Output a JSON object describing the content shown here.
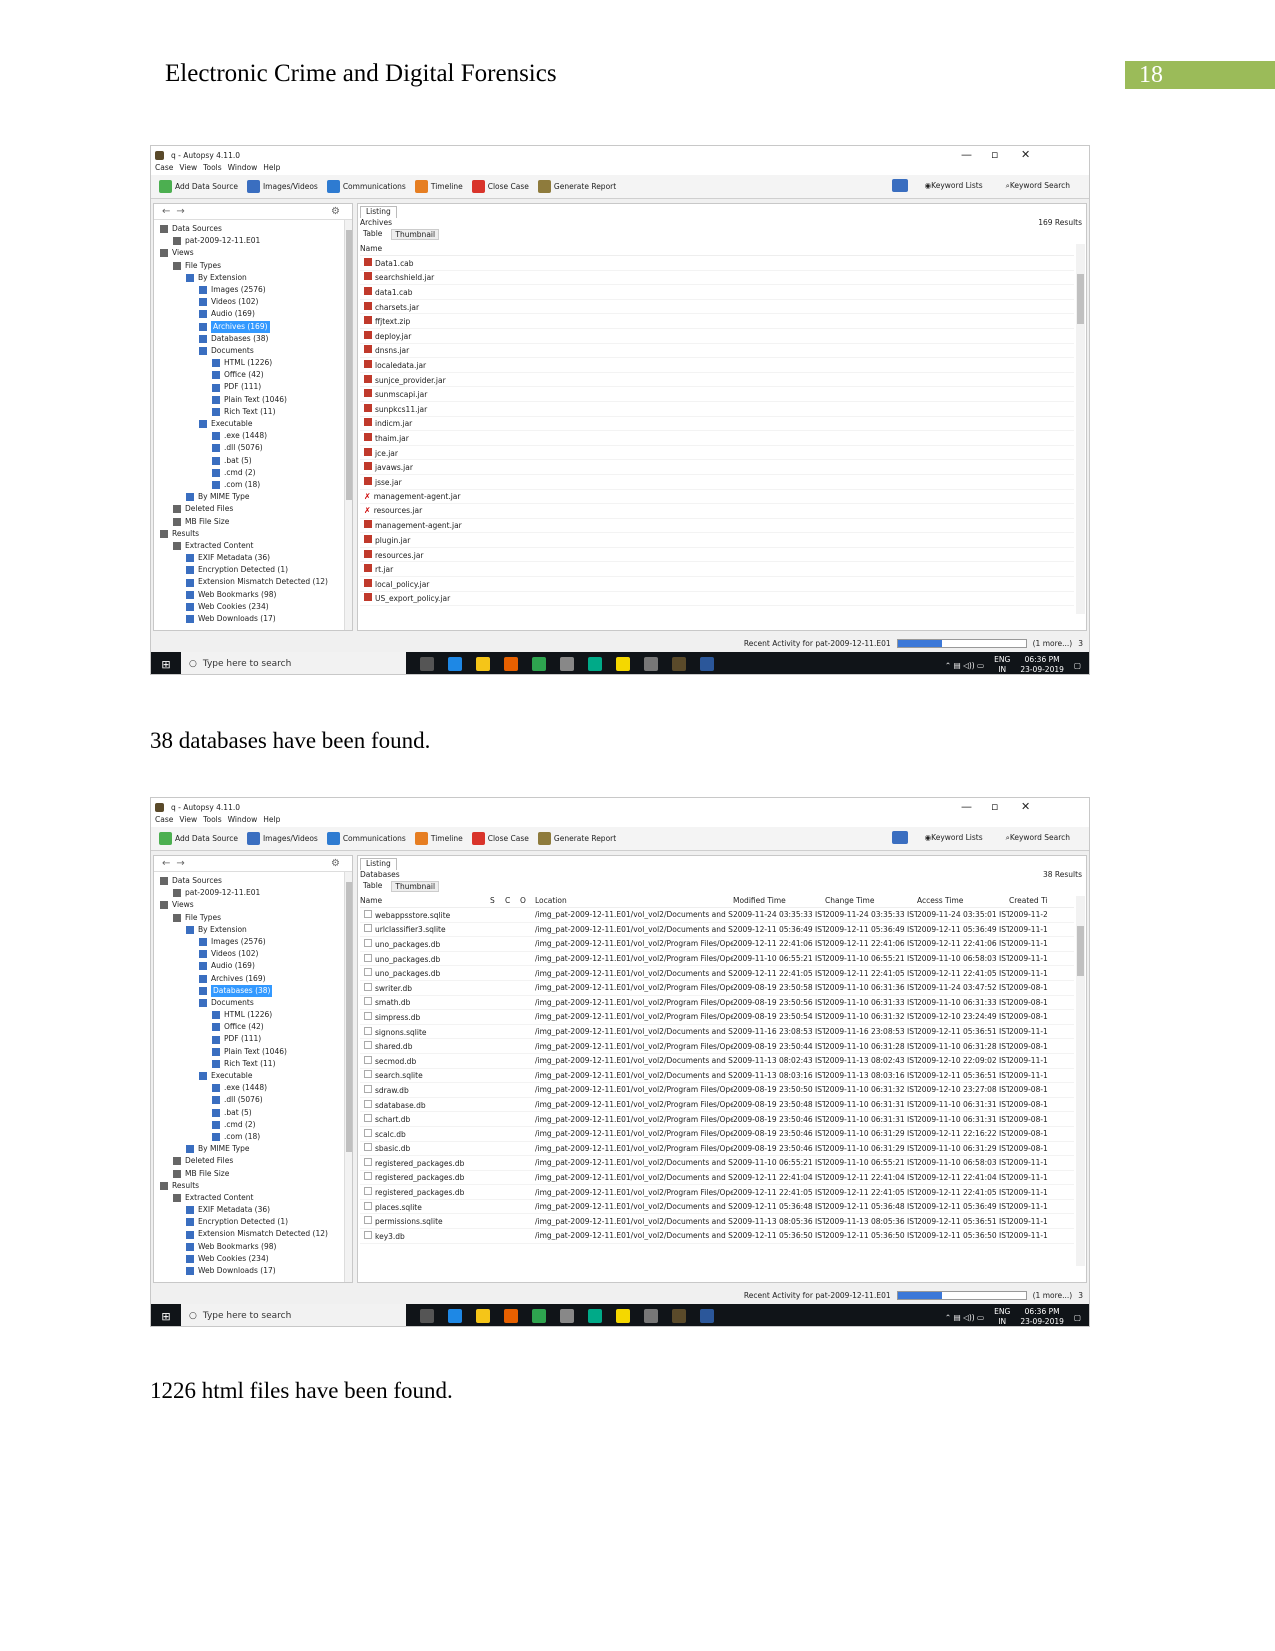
{
  "header": {
    "title": "Electronic Crime and Digital Forensics",
    "page_number": "18"
  },
  "captions": [
    "38 databases have been found.",
    "1226 html files have been found."
  ],
  "app": {
    "window_title": "q - Autopsy 4.11.0",
    "menu": [
      "Case",
      "View",
      "Tools",
      "Window",
      "Help"
    ],
    "toolbar": [
      "Add Data Source",
      "Images/Videos",
      "Communications",
      "Timeline",
      "Close Case",
      "Generate Report"
    ],
    "toolbar_right": [
      "Keyword Lists",
      "Keyword Search"
    ],
    "listing_tab": "Listing",
    "subtabs": [
      "Table",
      "Thumbnail"
    ],
    "tree": [
      {
        "label": "Data Sources",
        "indent": 0
      },
      {
        "label": "pat-2009-12-11.E01",
        "indent": 1
      },
      {
        "label": "Views",
        "indent": 0
      },
      {
        "label": "File Types",
        "indent": 1
      },
      {
        "label": "By Extension",
        "indent": 2
      },
      {
        "label": "Images (2576)",
        "indent": 3
      },
      {
        "label": "Videos (102)",
        "indent": 3
      },
      {
        "label": "Audio (169)",
        "indent": 3
      },
      {
        "label": "Archives (169)",
        "indent": 3
      },
      {
        "label": "Databases (38)",
        "indent": 3
      },
      {
        "label": "Documents",
        "indent": 3
      },
      {
        "label": "HTML (1226)",
        "indent": 4
      },
      {
        "label": "Office (42)",
        "indent": 4
      },
      {
        "label": "PDF (111)",
        "indent": 4
      },
      {
        "label": "Plain Text (1046)",
        "indent": 4
      },
      {
        "label": "Rich Text (11)",
        "indent": 4
      },
      {
        "label": "Executable",
        "indent": 3
      },
      {
        "label": ".exe (1448)",
        "indent": 4
      },
      {
        "label": ".dll (5076)",
        "indent": 4
      },
      {
        "label": ".bat (5)",
        "indent": 4
      },
      {
        "label": ".cmd (2)",
        "indent": 4
      },
      {
        "label": ".com (18)",
        "indent": 4
      },
      {
        "label": "By MIME Type",
        "indent": 2
      },
      {
        "label": "Deleted Files",
        "indent": 1
      },
      {
        "label": "MB File Size",
        "indent": 1
      },
      {
        "label": "Results",
        "indent": 0
      },
      {
        "label": "Extracted Content",
        "indent": 1
      },
      {
        "label": "EXIF Metadata (36)",
        "indent": 2
      },
      {
        "label": "Encryption Detected (1)",
        "indent": 2
      },
      {
        "label": "Extension Mismatch Detected (12)",
        "indent": 2
      },
      {
        "label": "Web Bookmarks (98)",
        "indent": 2
      },
      {
        "label": "Web Cookies (234)",
        "indent": 2
      },
      {
        "label": "Web Downloads (17)",
        "indent": 2
      }
    ],
    "status": {
      "recent_activity": "Recent Activity for pat-2009-12-11.E01",
      "progress_label": "35%",
      "progress": 0.35,
      "more": "(1 more...)",
      "count": "3"
    },
    "taskbar": {
      "search_placeholder": "Type here to search",
      "lang": "ENG",
      "region": "IN",
      "time": "06:36 PM",
      "date": "23-09-2019"
    }
  },
  "screens": [
    {
      "result_title": "Archives",
      "result_count": "169 Results",
      "selected_tree": "Archives (169)",
      "columns": [
        "Name"
      ],
      "rows": [
        [
          "Data1.cab",
          "f"
        ],
        [
          "searchshield.jar",
          "f"
        ],
        [
          "data1.cab",
          "f"
        ],
        [
          "charsets.jar",
          "f"
        ],
        [
          "ffjtext.zip",
          "f"
        ],
        [
          "deploy.jar",
          "f"
        ],
        [
          "dnsns.jar",
          "f"
        ],
        [
          "localedata.jar",
          "f"
        ],
        [
          "sunjce_provider.jar",
          "f"
        ],
        [
          "sunmscapi.jar",
          "f"
        ],
        [
          "sunpkcs11.jar",
          "f"
        ],
        [
          "indicm.jar",
          "f"
        ],
        [
          "thaim.jar",
          "f"
        ],
        [
          "jce.jar",
          "f"
        ],
        [
          "javaws.jar",
          "f"
        ],
        [
          "jsse.jar",
          "f"
        ],
        [
          "management-agent.jar",
          "x"
        ],
        [
          "resources.jar",
          "x"
        ],
        [
          "management-agent.jar",
          "f"
        ],
        [
          "plugin.jar",
          "f"
        ],
        [
          "resources.jar",
          "f"
        ],
        [
          "rt.jar",
          "f"
        ],
        [
          "local_policy.jar",
          "f"
        ],
        [
          "US_export_policy.jar",
          "f"
        ]
      ]
    },
    {
      "result_title": "Databases",
      "result_count": "38 Results",
      "selected_tree": "Databases (38)",
      "columns": [
        "Name",
        "S",
        "C",
        "O",
        "Location",
        "Modified Time",
        "Change Time",
        "Access Time",
        "Created Ti"
      ],
      "rows": [
        [
          "webappsstore.sqlite",
          "/img_pat-2009-12-11.E01/vol_vol2/Documents and Setting...",
          "2009-11-24 03:35:33 IST",
          "2009-11-24 03:35:33 IST",
          "2009-11-24 03:35:01 IST",
          "2009-11-2"
        ],
        [
          "urlclassifier3.sqlite",
          "/img_pat-2009-12-11.E01/vol_vol2/Documents and Setting...",
          "2009-12-11 05:36:49 IST",
          "2009-12-11 05:36:49 IST",
          "2009-12-11 05:36:49 IST",
          "2009-11-1"
        ],
        [
          "uno_packages.db",
          "/img_pat-2009-12-11.E01/vol_vol2/Program Files/OpenOffi...",
          "2009-12-11 22:41:06 IST",
          "2009-12-11 22:41:06 IST",
          "2009-12-11 22:41:06 IST",
          "2009-11-1"
        ],
        [
          "uno_packages.db",
          "/img_pat-2009-12-11.E01/vol_vol2/Program Files/OpenOffi...",
          "2009-11-10 06:55:21 IST",
          "2009-11-10 06:55:21 IST",
          "2009-11-10 06:58:03 IST",
          "2009-11-1"
        ],
        [
          "uno_packages.db",
          "/img_pat-2009-12-11.E01/vol_vol2/Documents and Setting...",
          "2009-12-11 22:41:05 IST",
          "2009-12-11 22:41:05 IST",
          "2009-12-11 22:41:05 IST",
          "2009-11-1"
        ],
        [
          "swriter.db",
          "/img_pat-2009-12-11.E01/vol_vol2/Program Files/OpenOffi...",
          "2009-08-19 23:50:58 IST",
          "2009-11-10 06:31:36 IST",
          "2009-11-24 03:47:52 IST",
          "2009-08-1"
        ],
        [
          "smath.db",
          "/img_pat-2009-12-11.E01/vol_vol2/Program Files/OpenOffi...",
          "2009-08-19 23:50:56 IST",
          "2009-11-10 06:31:33 IST",
          "2009-11-10 06:31:33 IST",
          "2009-08-1"
        ],
        [
          "simpress.db",
          "/img_pat-2009-12-11.E01/vol_vol2/Program Files/OpenOffi...",
          "2009-08-19 23:50:54 IST",
          "2009-11-10 06:31:32 IST",
          "2009-12-10 23:24:49 IST",
          "2009-08-1"
        ],
        [
          "signons.sqlite",
          "/img_pat-2009-12-11.E01/vol_vol2/Documents and Setting...",
          "2009-11-16 23:08:53 IST",
          "2009-11-16 23:08:53 IST",
          "2009-12-11 05:36:51 IST",
          "2009-11-1"
        ],
        [
          "shared.db",
          "/img_pat-2009-12-11.E01/vol_vol2/Program Files/OpenOffi...",
          "2009-08-19 23:50:44 IST",
          "2009-11-10 06:31:28 IST",
          "2009-11-10 06:31:28 IST",
          "2009-08-1"
        ],
        [
          "secmod.db",
          "/img_pat-2009-12-11.E01/vol_vol2/Documents and Setting...",
          "2009-11-13 08:02:43 IST",
          "2009-11-13 08:02:43 IST",
          "2009-12-10 22:09:02 IST",
          "2009-11-1"
        ],
        [
          "search.sqlite",
          "/img_pat-2009-12-11.E01/vol_vol2/Documents and Setting...",
          "2009-11-13 08:03:16 IST",
          "2009-11-13 08:03:16 IST",
          "2009-12-11 05:36:51 IST",
          "2009-11-1"
        ],
        [
          "sdraw.db",
          "/img_pat-2009-12-11.E01/vol_vol2/Program Files/OpenOffi...",
          "2009-08-19 23:50:50 IST",
          "2009-11-10 06:31:32 IST",
          "2009-12-10 23:27:08 IST",
          "2009-08-1"
        ],
        [
          "sdatabase.db",
          "/img_pat-2009-12-11.E01/vol_vol2/Program Files/OpenOffi...",
          "2009-08-19 23:50:48 IST",
          "2009-11-10 06:31:31 IST",
          "2009-11-10 06:31:31 IST",
          "2009-08-1"
        ],
        [
          "schart.db",
          "/img_pat-2009-12-11.E01/vol_vol2/Program Files/OpenOffi...",
          "2009-08-19 23:50:46 IST",
          "2009-11-10 06:31:31 IST",
          "2009-11-10 06:31:31 IST",
          "2009-08-1"
        ],
        [
          "scalc.db",
          "/img_pat-2009-12-11.E01/vol_vol2/Program Files/OpenOffi...",
          "2009-08-19 23:50:46 IST",
          "2009-11-10 06:31:29 IST",
          "2009-12-11 22:16:22 IST",
          "2009-08-1"
        ],
        [
          "sbasic.db",
          "/img_pat-2009-12-11.E01/vol_vol2/Program Files/OpenOffi...",
          "2009-08-19 23:50:46 IST",
          "2009-11-10 06:31:29 IST",
          "2009-11-10 06:31:29 IST",
          "2009-08-1"
        ],
        [
          "registered_packages.db",
          "/img_pat-2009-12-11.E01/vol_vol2/Documents and Setting...",
          "2009-11-10 06:55:21 IST",
          "2009-11-10 06:55:21 IST",
          "2009-11-10 06:58:03 IST",
          "2009-11-1"
        ],
        [
          "registered_packages.db",
          "/img_pat-2009-12-11.E01/vol_vol2/Documents and Setting...",
          "2009-12-11 22:41:04 IST",
          "2009-12-11 22:41:04 IST",
          "2009-12-11 22:41:04 IST",
          "2009-11-1"
        ],
        [
          "registered_packages.db",
          "/img_pat-2009-12-11.E01/vol_vol2/Program Files/OpenOffi...",
          "2009-12-11 22:41:05 IST",
          "2009-12-11 22:41:05 IST",
          "2009-12-11 22:41:05 IST",
          "2009-11-1"
        ],
        [
          "places.sqlite",
          "/img_pat-2009-12-11.E01/vol_vol2/Documents and Setting...",
          "2009-12-11 05:36:48 IST",
          "2009-12-11 05:36:48 IST",
          "2009-12-11 05:36:49 IST",
          "2009-11-1"
        ],
        [
          "permissions.sqlite",
          "/img_pat-2009-12-11.E01/vol_vol2/Documents and Setting...",
          "2009-11-13 08:05:36 IST",
          "2009-11-13 08:05:36 IST",
          "2009-12-11 05:36:51 IST",
          "2009-11-1"
        ],
        [
          "key3.db",
          "/img_pat-2009-12-11.E01/vol_vol2/Documents and Setting...",
          "2009-12-11 05:36:50 IST",
          "2009-12-11 05:36:50 IST",
          "2009-12-11 05:36:50 IST",
          "2009-11-1"
        ]
      ]
    }
  ]
}
